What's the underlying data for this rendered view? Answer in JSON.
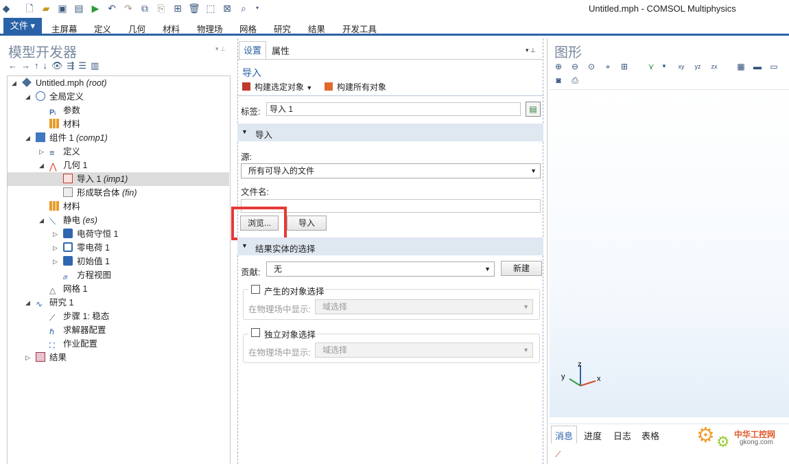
{
  "window": {
    "title": "Untitled.mph - COMSOL Multiphysics"
  },
  "ribbon": {
    "file_label": "文件 ▾",
    "tabs": [
      "主屏幕",
      "定义",
      "几何",
      "材料",
      "物理场",
      "网格",
      "研究",
      "结果",
      "开发工具"
    ]
  },
  "model_builder": {
    "title": "模型开发器",
    "tree": [
      {
        "label": "Untitled.mph",
        "italic": "(root)"
      },
      {
        "label": "全局定义",
        "italic": ""
      },
      {
        "label": "参数",
        "italic": ""
      },
      {
        "label": "材料",
        "italic": ""
      },
      {
        "label": "组件 1",
        "italic": "(comp1)"
      },
      {
        "label": "定义",
        "italic": ""
      },
      {
        "label": "几何 1",
        "italic": ""
      },
      {
        "label": "导入 1",
        "italic": "(imp1)"
      },
      {
        "label": "形成联合体",
        "italic": "(fin)"
      },
      {
        "label": "材料",
        "italic": ""
      },
      {
        "label": "静电",
        "italic": "(es)"
      },
      {
        "label": "电荷守恒 1",
        "italic": ""
      },
      {
        "label": "零电荷 1",
        "italic": ""
      },
      {
        "label": "初始值 1",
        "italic": ""
      },
      {
        "label": "方程视图",
        "italic": ""
      },
      {
        "label": "网格 1",
        "italic": ""
      },
      {
        "label": "研究 1",
        "italic": ""
      },
      {
        "label": "步骤 1: 稳态",
        "italic": ""
      },
      {
        "label": "求解器配置",
        "italic": ""
      },
      {
        "label": "作业配置",
        "italic": ""
      },
      {
        "label": "结果",
        "italic": ""
      }
    ]
  },
  "settings": {
    "tabs": [
      "设置",
      "属性"
    ],
    "node_title": "导入",
    "build_selected": "构建选定对象",
    "build_all": "构建所有对象",
    "label_caption": "标签:",
    "label_value": "导入 1",
    "import_section": "导入",
    "source_caption": "源:",
    "source_value": "所有可导入的文件",
    "filename_caption": "文件名:",
    "filename_value": "",
    "browse_button": "浏览...",
    "import_button": "导入",
    "result_section": "结果实体的选择",
    "contribute_caption": "贡献:",
    "contribute_value": "无",
    "new_button": "新建",
    "group1_checkbox": "产生的对象选择",
    "group1_show_caption": "在物理场中显示:",
    "group1_show_value": "域选择",
    "group2_checkbox": "独立对象选择",
    "group2_show_caption": "在物理场中显示:",
    "group2_show_value": "域选择"
  },
  "graphics": {
    "title": "图形",
    "axes": {
      "x": "x",
      "y": "y",
      "z": "z"
    },
    "bottom_tabs": [
      "消息",
      "进度",
      "日志",
      "表格"
    ],
    "watermark": {
      "text": "中华工控网",
      "url": "gkong.com"
    }
  },
  "colors": {
    "accent": "#2a62a8",
    "highlight": "#e53935",
    "section_bg": "#dfe7f1"
  }
}
